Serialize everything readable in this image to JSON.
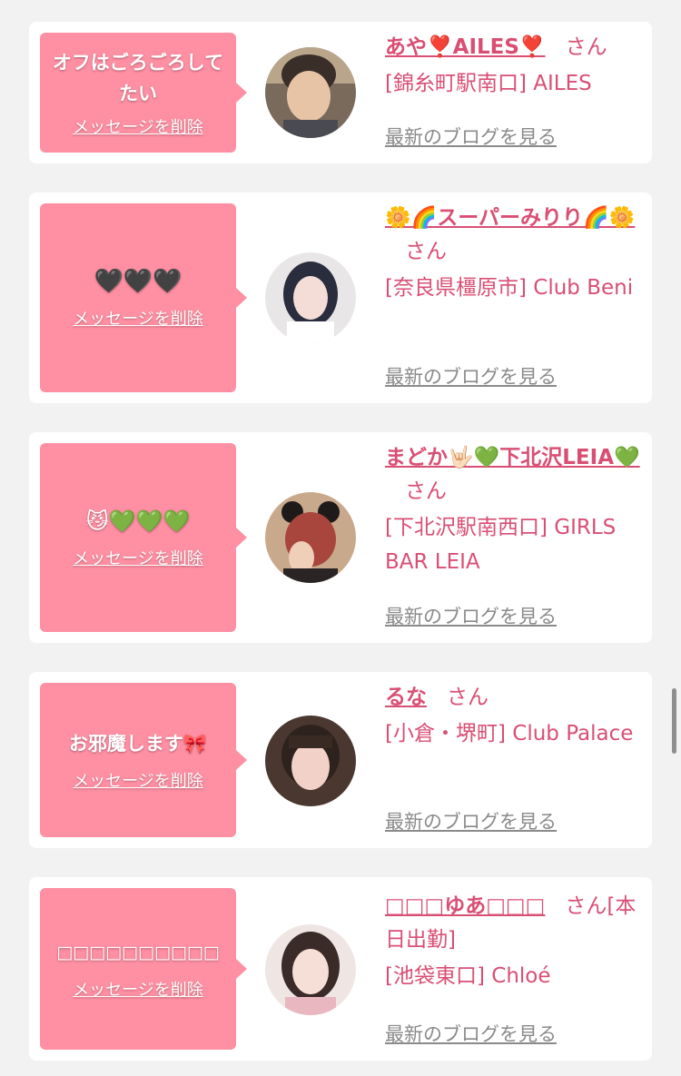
{
  "delete_label": "メッセージを削除",
  "blog_label": "最新のブログを見る",
  "san_label": "さん",
  "cards": [
    {
      "message": "オフはごろごろしてたい",
      "name": "あや❣️AILES❣️",
      "san": "さん",
      "shop": "[錦糸町駅南口] AILES"
    },
    {
      "message": "🖤🖤🖤",
      "name": "🌼🌈スーパーみりり🌈🌼",
      "san": "さん",
      "shop": "[奈良県橿原市] Club Beni"
    },
    {
      "message": "😼💚💚💚",
      "name": "まどか🤟🏻💚下北沢LEIA💚",
      "san": "さん",
      "shop": "[下北沢駅南西口] GIRLS BAR LEIA"
    },
    {
      "message": "お邪魔します🎀",
      "name": "るな",
      "san": "さん",
      "shop": "[小倉・堺町] Club Palace"
    },
    {
      "message": "□□□□□□□□□□",
      "name": "□□□ゆあ□□□",
      "san": "さん[本日出勤]",
      "shop": "[池袋東口] Chloé"
    }
  ],
  "colors": {
    "bubble": "#ff8fa3",
    "accent": "#d94f74",
    "link_gray": "#8a8a8a",
    "background": "#f2f2f2"
  }
}
